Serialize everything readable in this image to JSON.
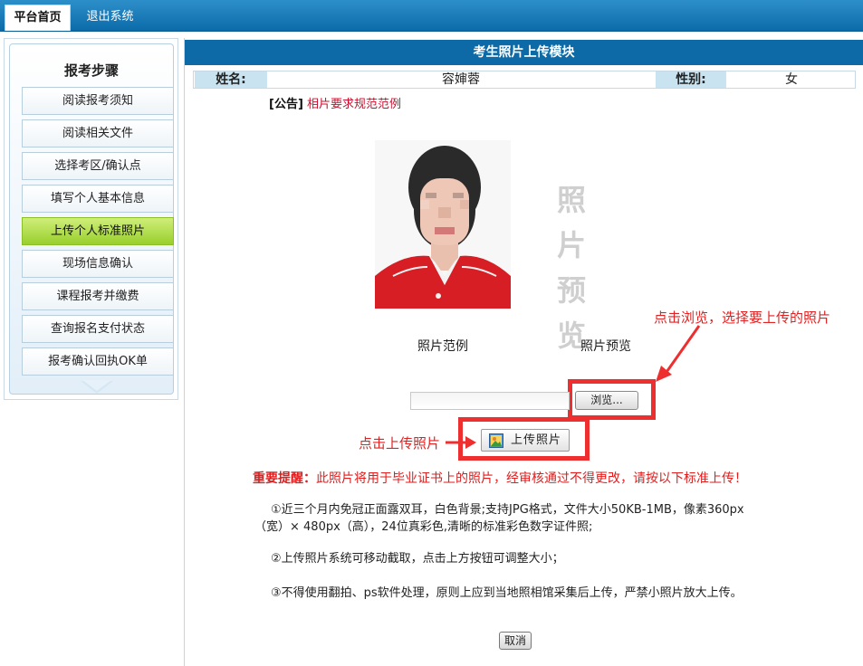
{
  "nav": {
    "tabs": [
      {
        "label": "平台首页"
      },
      {
        "label": "退出系统"
      }
    ]
  },
  "sidebar": {
    "title": "报考步骤",
    "items": [
      {
        "label": "阅读报考须知"
      },
      {
        "label": "阅读相关文件"
      },
      {
        "label": "选择考区/确认点"
      },
      {
        "label": "填写个人基本信息"
      },
      {
        "label": "上传个人标准照片",
        "active": true
      },
      {
        "label": "现场信息确认"
      },
      {
        "label": "课程报考并缴费"
      },
      {
        "label": "查询报名支付状态"
      },
      {
        "label": "报考确认回执OK单"
      }
    ]
  },
  "main": {
    "title": "考生照片上传模块",
    "info": {
      "name_label": "姓名:",
      "name_value": "容婶蓉",
      "gender_label": "性别:",
      "gender_value": "女"
    },
    "announcement": {
      "prefix": "[公告]",
      "link_text": "相片要求规范范例"
    },
    "preview_placeholder": {
      "line1": "照片",
      "line2": "预览"
    },
    "captions": {
      "sample": "照片范例",
      "preview": "照片预览"
    },
    "annotations": {
      "browse_hint": "点击浏览，选择要上传的照片",
      "upload_hint": "点击上传照片"
    },
    "file_input": {
      "value": "",
      "browse_label": "浏览..."
    },
    "upload_button_label": "上传照片",
    "reminder": {
      "title": "重要提醒：",
      "text": "此照片将用于毕业证书上的照片，经审核通过不得更改，请按以下标准上传！"
    },
    "rules": [
      "①近三个月内免冠正面露双耳，白色背景;支持JPG格式，文件大小50KB-1MB，像素360px",
      "（宽）× 480px（高），24位真彩色,清晰的标准彩色数字证件照;",
      "②上传照片系统可移动截取，点击上方按钮可调整大小；",
      "③不得使用翻拍、ps软件处理，原则上应到当地照相馆采集后上传，严禁小照片放大上传。"
    ],
    "cancel_label": "取消"
  },
  "colors": {
    "header_blue": "#0d6aa6",
    "active_green": "#99cf2c",
    "annotation_red": "#ee2f2f"
  }
}
